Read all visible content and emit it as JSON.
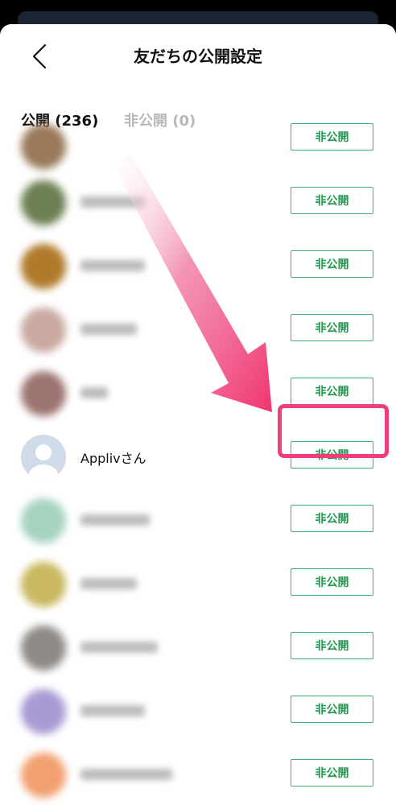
{
  "header": {
    "title": "友だちの公開設定",
    "back_icon": "chevron-left-icon"
  },
  "tabs": [
    {
      "label": "公開 (236)",
      "active": true
    },
    {
      "label": "非公開 (0)",
      "active": false
    }
  ],
  "rows": [
    {
      "name": "",
      "button": "非公開",
      "blurred": true,
      "avatar_color": "#9a7a5a"
    },
    {
      "name": "",
      "button": "非公開",
      "blurred": true,
      "avatar_color": "#6d8054"
    },
    {
      "name": "",
      "button": "非公開",
      "blurred": true,
      "avatar_color": "#b07a2a"
    },
    {
      "name": "",
      "button": "非公開",
      "blurred": true,
      "avatar_color": "#c9a9a0"
    },
    {
      "name": "",
      "button": "非公開",
      "blurred": true,
      "avatar_color": "#9c7470"
    },
    {
      "name": "Applivさん",
      "button": "非公開",
      "blurred": false,
      "avatar_color": "#cfdbe8"
    },
    {
      "name": "",
      "button": "非公開",
      "blurred": true,
      "avatar_color": "#a6d3c0"
    },
    {
      "name": "",
      "button": "非公開",
      "blurred": true,
      "avatar_color": "#c9b860"
    },
    {
      "name": "",
      "button": "非公開",
      "blurred": true,
      "avatar_color": "#8f8a86"
    },
    {
      "name": "",
      "button": "非公開",
      "blurred": true,
      "avatar_color": "#a99ad4"
    },
    {
      "name": "",
      "button": "非公開",
      "blurred": true,
      "avatar_color": "#f2a070"
    }
  ],
  "colors": {
    "accent_green": "#3cb371",
    "highlight_pink": "#ee3f79"
  }
}
